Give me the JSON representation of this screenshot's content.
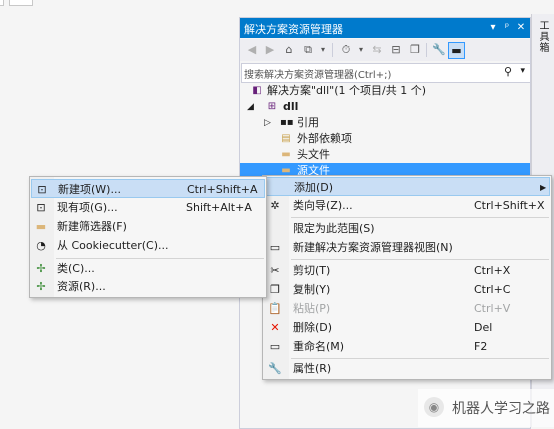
{
  "solution_explorer": {
    "title": "解决方案资源管理器",
    "title_buttons": [
      "▾",
      "ᵖ",
      "✕"
    ],
    "search_placeholder": "搜索解决方案资源管理器(Ctrl+;)",
    "tree": [
      {
        "label": "解决方案\"dll\"(1 个项目/共 1 个)",
        "icon": "solution-icon"
      },
      {
        "label": "dll",
        "icon": "cpp-project-icon",
        "expanded": true
      },
      {
        "label": "引用",
        "icon": "references-icon",
        "expanded": false
      },
      {
        "label": "外部依赖项",
        "icon": "external-deps-icon"
      },
      {
        "label": "头文件",
        "icon": "folder-icon"
      },
      {
        "label": "源文件",
        "icon": "folder-icon",
        "selected": true
      }
    ]
  },
  "toolbox": {
    "label": "工具箱"
  },
  "main_menu": {
    "items": [
      {
        "label": "添加(D)",
        "shortcut": "",
        "icon": "",
        "submenu": true,
        "hover": true
      },
      {
        "label": "类向导(Z)...",
        "shortcut": "Ctrl+Shift+X",
        "icon": "class-wizard-icon"
      },
      {
        "label": "限定为此范围(S)",
        "shortcut": "",
        "icon": ""
      },
      {
        "label": "新建解决方案资源管理器视图(N)",
        "shortcut": "",
        "icon": "new-view-icon"
      },
      {
        "label": "剪切(T)",
        "shortcut": "Ctrl+X",
        "icon": "cut-icon"
      },
      {
        "label": "复制(Y)",
        "shortcut": "Ctrl+C",
        "icon": "copy-icon"
      },
      {
        "label": "粘贴(P)",
        "shortcut": "Ctrl+V",
        "icon": "paste-icon",
        "disabled": true
      },
      {
        "label": "删除(D)",
        "shortcut": "Del",
        "icon": "delete-icon"
      },
      {
        "label": "重命名(M)",
        "shortcut": "F2",
        "icon": "rename-icon"
      },
      {
        "label": "属性(R)",
        "shortcut": "",
        "icon": "properties-icon"
      }
    ]
  },
  "add_submenu": {
    "items": [
      {
        "label": "新建项(W)...",
        "shortcut": "Ctrl+Shift+A",
        "icon": "new-item-icon",
        "hover": true
      },
      {
        "label": "现有项(G)...",
        "shortcut": "Shift+Alt+A",
        "icon": "existing-item-icon"
      },
      {
        "label": "新建筛选器(F)",
        "shortcut": "",
        "icon": "new-filter-icon"
      },
      {
        "label": "从 Cookiecutter(C)...",
        "shortcut": "",
        "icon": "cookiecutter-icon"
      },
      {
        "label": "类(C)...",
        "shortcut": "",
        "icon": "class-icon"
      },
      {
        "label": "资源(R)...",
        "shortcut": "",
        "icon": "resource-icon"
      }
    ]
  },
  "watermark": {
    "text": "机器人学习之路"
  },
  "colors": {
    "accent": "#007acc",
    "selection": "#3399ff",
    "hover": "#c9def5",
    "delete": "#e51400"
  }
}
